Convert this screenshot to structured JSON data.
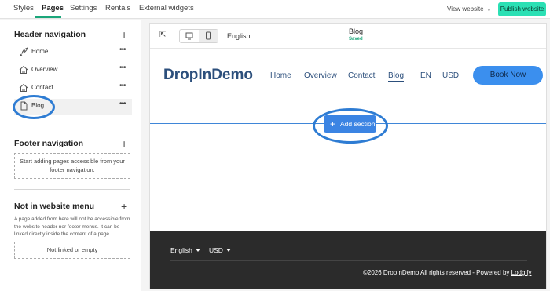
{
  "topbar": {
    "tabs": [
      {
        "label": "Styles"
      },
      {
        "label": "Pages"
      },
      {
        "label": "Settings"
      },
      {
        "label": "Rentals"
      },
      {
        "label": "External widgets"
      }
    ],
    "view_website": "View website",
    "publish": "Publish website",
    "accent": "#2be0b4"
  },
  "sidebar": {
    "header_nav": {
      "title": "Header navigation",
      "items": [
        {
          "label": "Home",
          "icon": "rocket-icon"
        },
        {
          "label": "Overview",
          "icon": "house-icon"
        },
        {
          "label": "Contact",
          "icon": "house-icon"
        },
        {
          "label": "Blog",
          "icon": "page-icon",
          "selected": true
        }
      ]
    },
    "footer_nav": {
      "title": "Footer navigation",
      "empty_text": "Start adding pages accessible from your footer navigation."
    },
    "not_in_menu": {
      "title": "Not in website menu",
      "note": "A page added from here will not be accessible from the website header nor footer menus. It can be linked directly inside the content of a page.",
      "empty_text": "Not linked or empty"
    }
  },
  "editor": {
    "language": "English",
    "page_name": "Blog",
    "page_status": "Saved",
    "site": {
      "brand": "DropInDemo",
      "menu": [
        "Home",
        "Overview",
        "Contact",
        "Blog",
        "EN",
        "USD"
      ],
      "book_button": "Book Now",
      "add_section": "Add section",
      "footer": {
        "language": "English",
        "currency": "USD",
        "copyright": "©2026 DropInDemo All rights reserved - Powered by ",
        "powered_link": "Lodgify"
      }
    }
  }
}
